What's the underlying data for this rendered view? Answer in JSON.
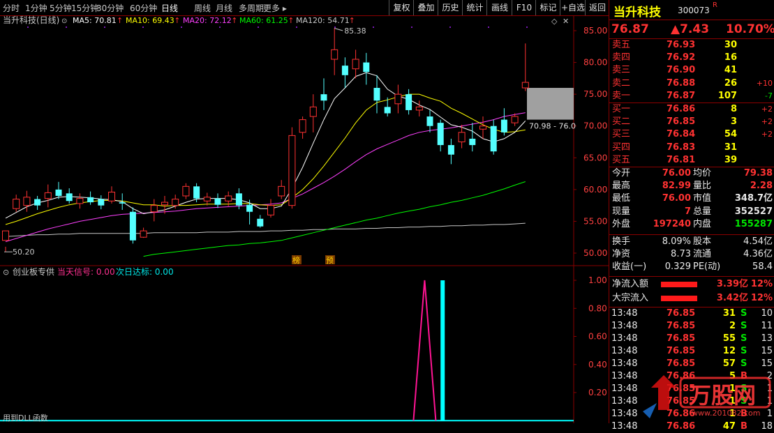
{
  "toolbar": {
    "periods": [
      "分时",
      "1分钟",
      "5分钟",
      "15分钟",
      "30分钟",
      "60分钟",
      "日线",
      "周线",
      "月线",
      "多周期",
      "更多 ▸"
    ],
    "active": "日线",
    "actions": [
      "复权",
      "叠加",
      "历史",
      "统计",
      "画线",
      "F10",
      "标记",
      "+自选",
      "返回"
    ]
  },
  "chart": {
    "title": "当升科技(日线)",
    "ma_labels": [
      {
        "text": "MA5: 70.81",
        "color": "#ffffff"
      },
      {
        "text": "MA10: 69.43",
        "color": "#ffff00"
      },
      {
        "text": "MA20: 72.12",
        "color": "#ff40ff"
      },
      {
        "text": "MA60: 61.25",
        "color": "#00ff00"
      },
      {
        "text": "MA120: 54.71",
        "color": "#c8c8c8"
      }
    ],
    "y_ticks": [
      "85.00",
      "80.00",
      "75.00",
      "70.00",
      "65.00",
      "60.00",
      "55.00",
      "50.00"
    ],
    "high_label": "85.38",
    "low_label": "50.20",
    "range_label": "70.98 - 76.0",
    "markers": [
      "榜",
      "预"
    ],
    "sub_title": "创业板专供",
    "sub_signal": "当天信号: 0.00",
    "sub_next": "次日达标: 0.00",
    "sub_ticks": [
      "1.00",
      "0.80",
      "0.60",
      "0.40",
      "0.20"
    ],
    "sub_footer": "用到DLL函数"
  },
  "chart_data": {
    "type": "candlestick",
    "candles": [
      [
        52.0,
        53.5,
        51.0,
        50.2
      ],
      [
        57.0,
        58.5,
        59.2,
        56.5
      ],
      [
        57.5,
        58.8,
        59.8,
        56.5
      ],
      [
        58.5,
        57.5,
        59.0,
        56.8
      ],
      [
        58.6,
        59.5,
        60.8,
        57.2
      ],
      [
        60.0,
        59.0,
        61.2,
        58.5
      ],
      [
        59.4,
        58.2,
        60.2,
        57.8
      ],
      [
        57.8,
        58.6,
        59.4,
        57.0
      ],
      [
        58.8,
        58.0,
        59.7,
        57.6
      ],
      [
        58.5,
        57.5,
        59.1,
        56.9
      ],
      [
        58.2,
        59.6,
        60.5,
        57.8
      ],
      [
        58.0,
        57.8,
        59.4,
        56.8
      ],
      [
        56.5,
        52.0,
        57.2,
        51.5
      ],
      [
        52.5,
        53.5,
        54.0,
        52.4
      ],
      [
        56.5,
        57.5,
        58.5,
        55.0
      ],
      [
        57.6,
        58.0,
        59.0,
        56.2
      ],
      [
        57.5,
        58.5,
        59.2,
        57.0
      ],
      [
        59.0,
        60.5,
        61.0,
        58.5
      ],
      [
        60.5,
        58.6,
        61.0,
        58.0
      ],
      [
        58.2,
        58.8,
        59.5,
        57.5
      ],
      [
        58.6,
        57.6,
        59.4,
        57.1
      ],
      [
        58.2,
        59.0,
        59.7,
        57.4
      ],
      [
        59.4,
        57.5,
        60.2,
        56.9
      ],
      [
        57.6,
        56.5,
        58.4,
        54.5
      ],
      [
        55.4,
        54.2,
        56.0,
        54.0
      ],
      [
        56.0,
        57.5,
        58.5,
        55.6
      ],
      [
        59.0,
        60.5,
        61.5,
        58.5
      ],
      [
        57.5,
        68.5,
        69.8,
        57.0
      ],
      [
        69.0,
        71.0,
        71.5,
        68.0
      ],
      [
        71.5,
        73.0,
        75.0,
        69.0
      ],
      [
        75.0,
        74.0,
        77.5,
        72.5
      ],
      [
        80.5,
        82.0,
        85.4,
        78.0
      ],
      [
        79.5,
        78.0,
        80.8,
        76.0
      ],
      [
        79.0,
        80.5,
        82.0,
        77.5
      ],
      [
        80.0,
        78.5,
        81.5,
        76.5
      ],
      [
        76.0,
        74.0,
        78.0,
        72.0
      ],
      [
        73.0,
        72.0,
        74.5,
        71.5
      ],
      [
        73.5,
        75.0,
        76.5,
        72.0
      ],
      [
        75.0,
        72.5,
        75.8,
        71.8
      ],
      [
        72.5,
        73.0,
        74.0,
        71.5
      ],
      [
        71.5,
        70.0,
        72.5,
        69.0
      ],
      [
        70.5,
        67.0,
        71.0,
        66.0
      ],
      [
        67.0,
        65.5,
        68.0,
        64.0
      ],
      [
        67.5,
        69.0,
        70.2,
        66.5
      ],
      [
        68.0,
        67.0,
        70.5,
        66.0
      ],
      [
        69.5,
        70.0,
        71.5,
        68.0
      ],
      [
        70.0,
        66.0,
        71.0,
        65.5
      ],
      [
        71.0,
        69.0,
        72.8,
        68.5
      ],
      [
        70.5,
        71.5,
        72.0,
        70.0
      ],
      [
        76.0,
        76.87,
        82.99,
        75.5
      ]
    ],
    "ma5": [
      55.5,
      56.4,
      57.3,
      57.9,
      58.3,
      58.8,
      58.9,
      58.8,
      58.7,
      58.5,
      58.4,
      58.1,
      57.0,
      56.2,
      56.5,
      56.8,
      57.4,
      58.0,
      58.5,
      58.6,
      58.6,
      58.6,
      58.4,
      57.9,
      57.0,
      57.0,
      57.4,
      60.2,
      63.5,
      67.3,
      71.0,
      74.3,
      76.0,
      77.8,
      78.4,
      77.9,
      75.8,
      74.7,
      74.2,
      73.3,
      72.6,
      71.4,
      70.2,
      69.8,
      69.2,
      68.0,
      67.5,
      68.0,
      69.0,
      70.8
    ],
    "ma10": [
      54.5,
      55.0,
      55.6,
      56.2,
      56.7,
      57.2,
      57.6,
      57.9,
      58.1,
      58.3,
      58.3,
      58.2,
      57.9,
      57.6,
      57.6,
      57.4,
      57.5,
      57.5,
      57.6,
      57.7,
      57.7,
      57.7,
      57.8,
      57.8,
      57.6,
      57.5,
      57.6,
      58.7,
      60.0,
      61.7,
      63.7,
      65.9,
      68.1,
      70.5,
      72.5,
      73.7,
      74.1,
      74.6,
      75.0,
      75.0,
      74.4,
      73.9,
      72.8,
      72.0,
      71.1,
      70.2,
      69.5,
      69.0,
      69.1,
      69.4
    ],
    "ma20": [
      51.8,
      52.3,
      52.8,
      53.3,
      53.8,
      54.2,
      54.6,
      55.0,
      55.3,
      55.6,
      55.9,
      56.1,
      56.2,
      56.3,
      56.4,
      56.5,
      56.6,
      56.8,
      57.0,
      57.1,
      57.2,
      57.3,
      57.4,
      57.5,
      57.6,
      57.7,
      57.9,
      58.6,
      59.3,
      60.2,
      61.1,
      62.1,
      63.2,
      64.4,
      65.5,
      66.4,
      67.1,
      67.8,
      68.5,
      69.0,
      69.3,
      69.5,
      69.7,
      70.0,
      70.3,
      70.6,
      71.0,
      71.5,
      71.8,
      72.1
    ],
    "ma60": [
      null,
      null,
      null,
      null,
      null,
      null,
      null,
      null,
      null,
      null,
      null,
      null,
      null,
      49.5,
      49.8,
      50.0,
      50.2,
      50.4,
      50.6,
      50.8,
      51.0,
      51.2,
      51.3,
      51.5,
      51.6,
      51.8,
      52.0,
      52.4,
      52.8,
      53.2,
      53.6,
      54.0,
      54.4,
      54.8,
      55.2,
      55.5,
      55.9,
      56.3,
      56.6,
      56.9,
      57.3,
      57.6,
      58.0,
      58.3,
      58.7,
      59.1,
      59.6,
      60.1,
      60.7,
      61.25
    ],
    "ma120": [
      52.6,
      52.7,
      52.8,
      52.9,
      52.9,
      53.0,
      53.0,
      53.1,
      53.1,
      53.1,
      53.1,
      53.1,
      53.1,
      53.1,
      53.2,
      53.2,
      53.2,
      53.2,
      53.2,
      53.3,
      53.3,
      53.3,
      53.4,
      53.4,
      53.4,
      53.5,
      53.5,
      53.6,
      53.6,
      53.7,
      53.7,
      53.8,
      53.8,
      53.8,
      53.9,
      53.9,
      54.0,
      54.0,
      54.1,
      54.1,
      54.2,
      54.2,
      54.3,
      54.3,
      54.4,
      54.4,
      54.5,
      54.5,
      54.6,
      54.71
    ],
    "ylim": [
      49,
      86
    ],
    "signal_ticks": [
      0,
      0.2,
      0.4,
      0.6,
      0.8,
      1.0
    ],
    "signal_lines": [
      {
        "index": 39.5,
        "value": 1.0,
        "color": "#ff1493"
      }
    ],
    "signal_bars": [
      {
        "index": 41.2,
        "value": 1.0,
        "color": "#00ffff"
      }
    ]
  },
  "panel": {
    "name": "当升科技",
    "code": "300073",
    "flag": "R",
    "price": "76.87",
    "change": "▲7.43",
    "pct": "10.70%",
    "asks": [
      {
        "label": "卖五",
        "price": "76.93",
        "vol": "30",
        "chg": ""
      },
      {
        "label": "卖四",
        "price": "76.92",
        "vol": "16",
        "chg": ""
      },
      {
        "label": "卖三",
        "price": "76.90",
        "vol": "41",
        "chg": ""
      },
      {
        "label": "卖二",
        "price": "76.88",
        "vol": "26",
        "chg": "+10"
      },
      {
        "label": "卖一",
        "price": "76.87",
        "vol": "107",
        "chg": "-7"
      }
    ],
    "bids": [
      {
        "label": "买一",
        "price": "76.86",
        "vol": "8",
        "chg": "+2"
      },
      {
        "label": "买二",
        "price": "76.85",
        "vol": "3",
        "chg": "+2"
      },
      {
        "label": "买三",
        "price": "76.84",
        "vol": "54",
        "chg": "+2"
      },
      {
        "label": "买四",
        "price": "76.83",
        "vol": "31",
        "chg": ""
      },
      {
        "label": "买五",
        "price": "76.81",
        "vol": "39",
        "chg": ""
      }
    ],
    "stats": [
      [
        "今开",
        "76.00",
        "均价",
        "79.38"
      ],
      [
        "最高",
        "82.99",
        "量比",
        "2.28"
      ],
      [
        "最低",
        "76.00",
        "市值",
        "348.7亿"
      ],
      [
        "现量",
        "7",
        "总量",
        "352527"
      ],
      [
        "外盘",
        "197240",
        "内盘",
        "155287"
      ]
    ],
    "fund": [
      [
        "换手",
        "8.09%",
        "股本",
        "4.54亿"
      ],
      [
        "净资",
        "8.73",
        "流通",
        "4.36亿"
      ],
      [
        "收益(一)",
        "0.329",
        "PE(动)",
        "58.4"
      ]
    ],
    "flow": [
      {
        "label": "净流入额",
        "value": "3.39亿",
        "pct": "12%"
      },
      {
        "label": "大宗流入",
        "value": "3.42亿",
        "pct": "12%"
      }
    ],
    "ticks": [
      {
        "time": "13:48",
        "price": "76.85",
        "vol": "31",
        "side": "S",
        "n": "10"
      },
      {
        "time": "13:48",
        "price": "76.85",
        "vol": "2",
        "side": "S",
        "n": "11"
      },
      {
        "time": "13:48",
        "price": "76.85",
        "vol": "55",
        "side": "S",
        "n": "13"
      },
      {
        "time": "13:48",
        "price": "76.85",
        "vol": "12",
        "side": "S",
        "n": "15"
      },
      {
        "time": "13:48",
        "price": "76.85",
        "vol": "57",
        "side": "S",
        "n": "15"
      },
      {
        "time": "13:48",
        "price": "76.86",
        "vol": "5",
        "side": "B",
        "n": "2"
      },
      {
        "time": "13:48",
        "price": "76.85",
        "vol": "1",
        "side": "S",
        "n": "1"
      },
      {
        "time": "13:48",
        "price": "76.85",
        "vol": "1",
        "side": "S",
        "n": "1"
      },
      {
        "time": "13:48",
        "price": "76.86",
        "vol": "1",
        "side": "B",
        "n": "1"
      },
      {
        "time": "13:48",
        "price": "76.86",
        "vol": "47",
        "side": "B",
        "n": "18"
      }
    ],
    "watermark": "万股网",
    "watermark_url": "www.201082.com"
  }
}
